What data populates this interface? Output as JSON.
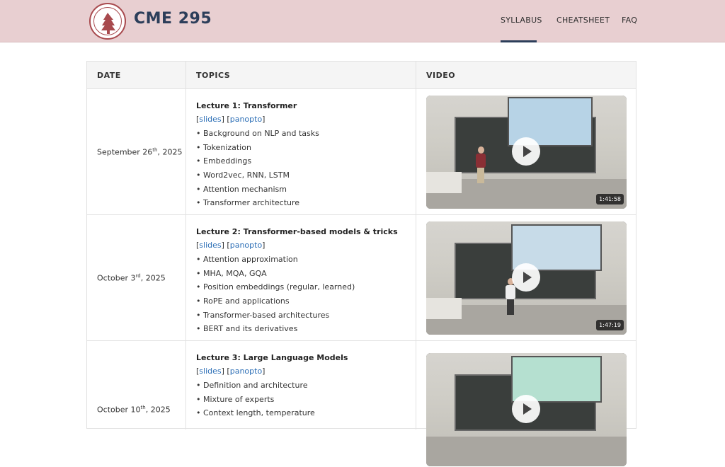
{
  "header": {
    "brand": "CME 295",
    "nav": [
      "SYLLABUS",
      "CHEATSHEET",
      "FAQ"
    ]
  },
  "table": {
    "columns": [
      "DATE",
      "TOPICS",
      "VIDEO"
    ],
    "rows": [
      {
        "date": "September 26",
        "date_suffix": "th",
        "year": ", 2025",
        "title": "Lecture 1: Transformer",
        "links": [
          "slides",
          "panopto"
        ],
        "bullets": [
          "Background on NLP and tasks",
          "Tokenization",
          "Embeddings",
          "Word2vec, RNN, LSTM",
          "Attention mechanism",
          "Transformer architecture"
        ],
        "duration": "1:41:58"
      },
      {
        "date": "October 3",
        "date_suffix": "rd",
        "year": ", 2025",
        "title": "Lecture 2: Transformer-based models & tricks",
        "links": [
          "slides",
          "panopto"
        ],
        "bullets": [
          "Attention approximation",
          "MHA, MQA, GQA",
          "Position embeddings (regular, learned)",
          "RoPE and applications",
          "Transformer-based architectures",
          "BERT and its derivatives"
        ],
        "duration": "1:47:19"
      },
      {
        "date": "October 10",
        "date_suffix": "th",
        "year": ", 2025",
        "title": "Lecture 3: Large Language Models",
        "links": [
          "slides",
          "panopto"
        ],
        "bullets": [
          "Definition and architecture",
          "Mixture of experts",
          "Context length, temperature"
        ],
        "duration": ""
      }
    ]
  },
  "colors": {
    "header_bg": "#e8cfd1",
    "brand": "#2c3e5a",
    "link": "#2a6db5"
  }
}
